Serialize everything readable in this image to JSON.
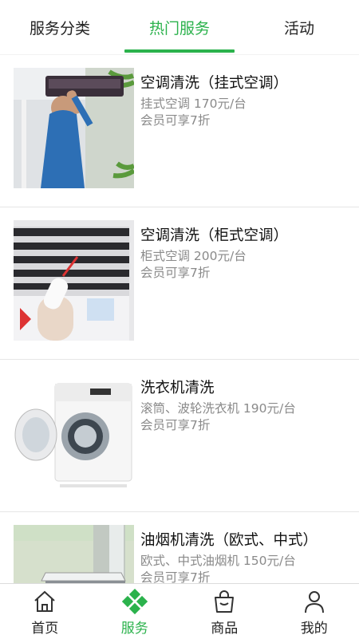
{
  "tabs": [
    {
      "label": "服务分类",
      "active": false
    },
    {
      "label": "热门服务",
      "active": true
    },
    {
      "label": "活动",
      "active": false
    }
  ],
  "accent_color": "#2bb24c",
  "services": [
    {
      "title": "空调清洗（挂式空调）",
      "subtitle": "挂式空调 170元/台",
      "note": "会员可享7折",
      "image": "wall-ac-cleaning-photo"
    },
    {
      "title": "空调清洗（柜式空调）",
      "subtitle": "柜式空调 200元/台",
      "note": "会员可享7折",
      "image": "cabinet-ac-cleaning-photo"
    },
    {
      "title": "洗衣机清洗",
      "subtitle": "滚筒、波轮洗衣机 190元/台",
      "note": "会员可享7折",
      "image": "washing-machine-photo"
    },
    {
      "title": "油烟机清洗（欧式、中式）",
      "subtitle": "欧式、中式油烟机  150元/台",
      "note": "会员可享7折",
      "image": "range-hood-photo"
    }
  ],
  "bottom_nav": [
    {
      "label": "首页",
      "icon": "home-icon",
      "active": false
    },
    {
      "label": "服务",
      "icon": "service-clover-icon",
      "active": true
    },
    {
      "label": "商品",
      "icon": "shopping-bag-icon",
      "active": false
    },
    {
      "label": "我的",
      "icon": "user-icon",
      "active": false
    }
  ]
}
